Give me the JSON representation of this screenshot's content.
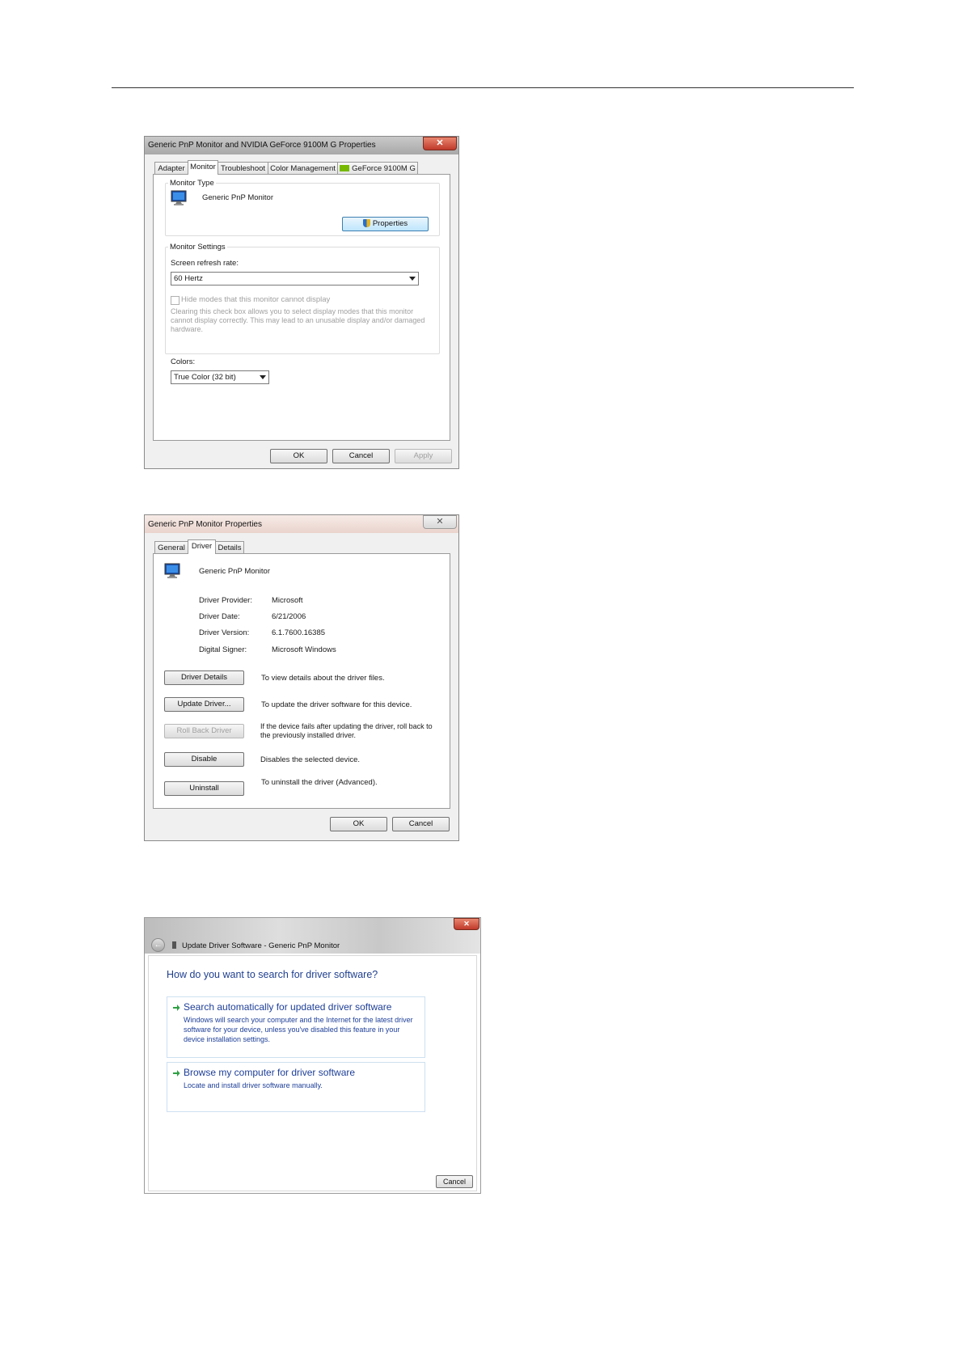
{
  "dialog1": {
    "title": "Generic PnP Monitor and NVIDIA GeForce 9100M G   Properties",
    "close_glyph": "✕",
    "tabs": [
      "Adapter",
      "Monitor",
      "Troubleshoot",
      "Color Management",
      "GeForce 9100M G"
    ],
    "monitor_type_heading": "Monitor Type",
    "monitor_name": "Generic PnP Monitor",
    "properties_button": "Properties",
    "monitor_settings_heading": "Monitor Settings",
    "refresh_rate_label": "Screen refresh rate:",
    "refresh_rate_value": "60 Hertz",
    "hide_modes_label": "Hide modes that this monitor cannot display",
    "hide_modes_desc": "Clearing this check box allows you to select display modes that this monitor cannot display correctly. This may lead to an unusable display and/or damaged hardware.",
    "colors_label": "Colors:",
    "colors_value": "True Color (32 bit)",
    "ok": "OK",
    "cancel": "Cancel",
    "apply": "Apply"
  },
  "dialog2": {
    "title": "Generic PnP Monitor Properties",
    "close_glyph": "✕",
    "tabs": [
      "General",
      "Driver",
      "Details"
    ],
    "device_name": "Generic PnP Monitor",
    "provider_label": "Driver Provider:",
    "provider_value": "Microsoft",
    "date_label": "Driver Date:",
    "date_value": "6/21/2006",
    "version_label": "Driver Version:",
    "version_value": "6.1.7600.16385",
    "signer_label": "Digital Signer:",
    "signer_value": "Microsoft Windows",
    "actions": [
      {
        "button": "Driver Details",
        "desc": "To view details about the driver files."
      },
      {
        "button": "Update Driver...",
        "desc": "To update the driver software for this device."
      },
      {
        "button": "Roll Back Driver",
        "desc": "If the device fails after updating the driver, roll back to the previously installed driver."
      },
      {
        "button": "Disable",
        "desc": "Disables the selected device."
      },
      {
        "button": "Uninstall",
        "desc": "To uninstall the driver (Advanced)."
      }
    ],
    "ok": "OK",
    "cancel": "Cancel"
  },
  "dialog3": {
    "title": "Update Driver Software - Generic PnP Monitor",
    "close_glyph": "✕",
    "question": "How do you want to search for driver software?",
    "option1_title": "Search automatically for updated driver software",
    "option1_desc": "Windows will search your computer and the Internet for the latest driver software for your device, unless you've disabled this feature in your device installation settings.",
    "option2_title": "Browse my computer for driver software",
    "option2_desc": "Locate and install driver software manually.",
    "cancel": "Cancel"
  },
  "colors": {
    "link_blue": "#1e3f98",
    "arrow_green": "#2ea043",
    "close_red": "#c0392b"
  }
}
